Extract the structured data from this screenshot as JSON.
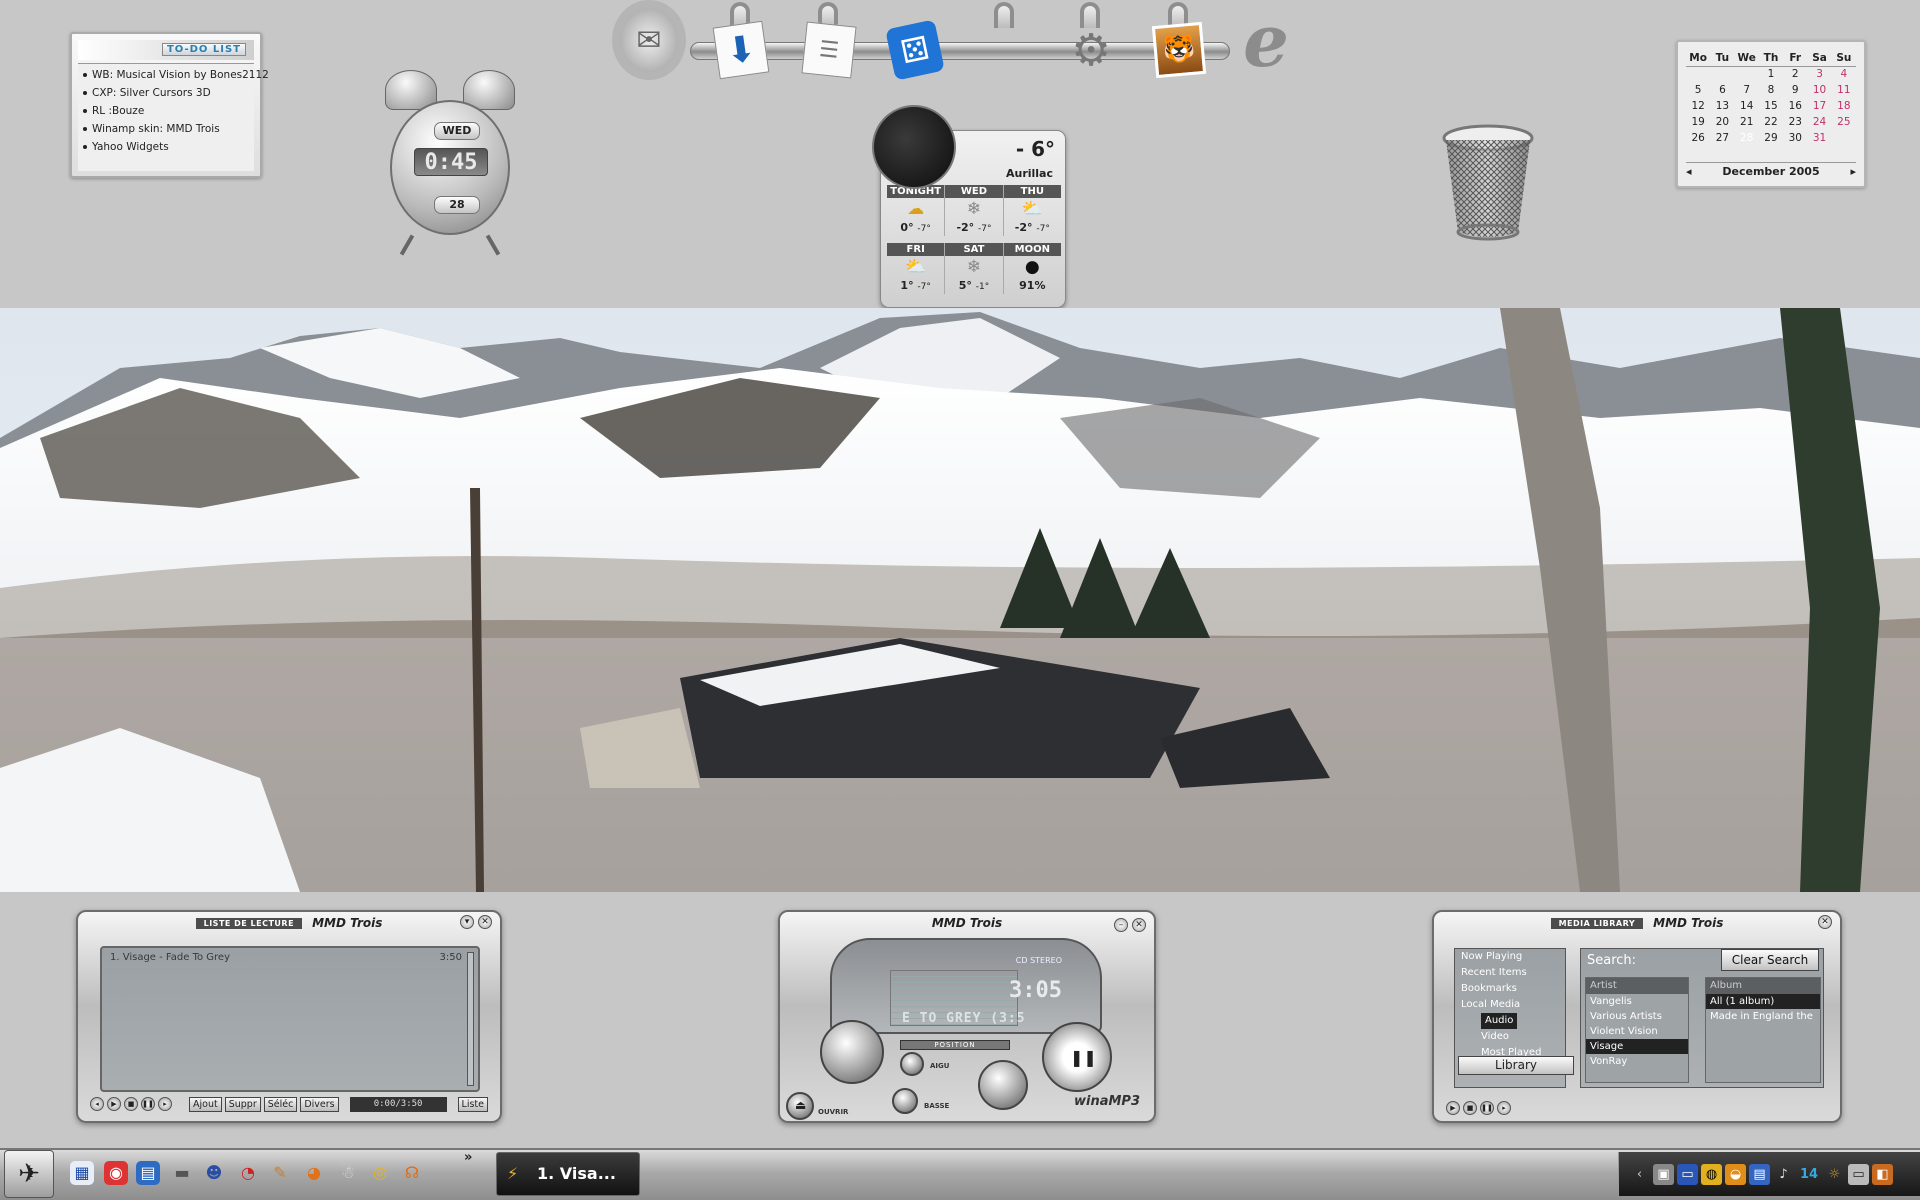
{
  "todo": {
    "title": "TO-DO LIST",
    "items": [
      "WB: Musical Vision  by Bones2112",
      "CXP: Silver Cursors 3D",
      "RL :Bouze",
      "Winamp skin: MMD Trois",
      "Yahoo Widgets"
    ]
  },
  "clock": {
    "day": "WED",
    "time": "0:45",
    "date": "28"
  },
  "dock": {
    "items": [
      {
        "icon": "mail-icon"
      },
      {
        "icon": "download-icon"
      },
      {
        "icon": "document-icon"
      },
      {
        "icon": "dice-icon"
      },
      {
        "icon": "empty-slot"
      },
      {
        "icon": "gear-icon"
      },
      {
        "icon": "tiger-photo-icon"
      },
      {
        "icon": "internet-explorer-icon"
      }
    ]
  },
  "weather": {
    "temp": "- 6°",
    "city": "Aurillac",
    "row1": [
      {
        "label": "TONIGHT",
        "icon": "cloud-moon-icon",
        "hi": "0°",
        "lo": "-7°"
      },
      {
        "label": "WED",
        "icon": "snow-icon",
        "hi": "-2°",
        "lo": "-7°"
      },
      {
        "label": "THU",
        "icon": "partly-sunny-icon",
        "hi": "-2°",
        "lo": "-7°"
      }
    ],
    "row2": [
      {
        "label": "FRI",
        "icon": "partly-sunny-icon",
        "hi": "1°",
        "lo": "-7°"
      },
      {
        "label": "SAT",
        "icon": "snow-icon",
        "hi": "5°",
        "lo": "-1°"
      },
      {
        "label": "MOON",
        "icon": "moon-icon",
        "value": "91%"
      }
    ]
  },
  "calendar": {
    "headers": [
      "Mo",
      "Tu",
      "We",
      "Th",
      "Fr",
      "Sa",
      "Su"
    ],
    "weeks": [
      [
        "",
        "",
        "",
        "1",
        "2",
        "3",
        "4"
      ],
      [
        "5",
        "6",
        "7",
        "8",
        "9",
        "10",
        "11"
      ],
      [
        "12",
        "13",
        "14",
        "15",
        "16",
        "17",
        "18"
      ],
      [
        "19",
        "20",
        "21",
        "22",
        "23",
        "24",
        "25"
      ],
      [
        "26",
        "27",
        "28",
        "29",
        "30",
        "31",
        ""
      ]
    ],
    "today": "28",
    "month_label": "December  2005",
    "prev": "◂",
    "next": "▸"
  },
  "playlist": {
    "caption": "LISTE DE LECTURE",
    "brand": "MMD Trois",
    "tracks": [
      {
        "title": "1. Visage - Fade To Grey",
        "length": "3:50"
      }
    ],
    "buttons": [
      "Ajout",
      "Suppr",
      "Séléc",
      "Divers"
    ],
    "time": "0:00/3:50",
    "list_button": "Liste"
  },
  "player": {
    "brand": "MMD Trois",
    "time": "3:05",
    "info": "CD STEREO",
    "marquee": "E TO GREY (3:5",
    "position_label": "POSITION",
    "aigu": "AIGU",
    "basse": "BASSE",
    "ouvrir": "OUVRIR",
    "logo": "winaMP3"
  },
  "library": {
    "caption": "MEDIA LIBRARY",
    "brand": "MMD Trois",
    "tree": [
      "Now Playing",
      "Recent Items",
      "Bookmarks",
      "Local Media",
      "Audio",
      "Video",
      "Most Played"
    ],
    "library_button": "Library",
    "search_label": "Search:",
    "clear_button": "Clear Search",
    "artist_header": "Artist",
    "artists": [
      "Vangelis",
      "Various Artists",
      "Violent Vision",
      "Visage",
      "VonRay"
    ],
    "selected_artist": "Visage",
    "album_header": "Album",
    "albums": [
      "All (1 album)",
      "Made in England the"
    ]
  },
  "taskbar": {
    "active_task": "1. Visa...",
    "chevron": "»",
    "clock": "14"
  }
}
